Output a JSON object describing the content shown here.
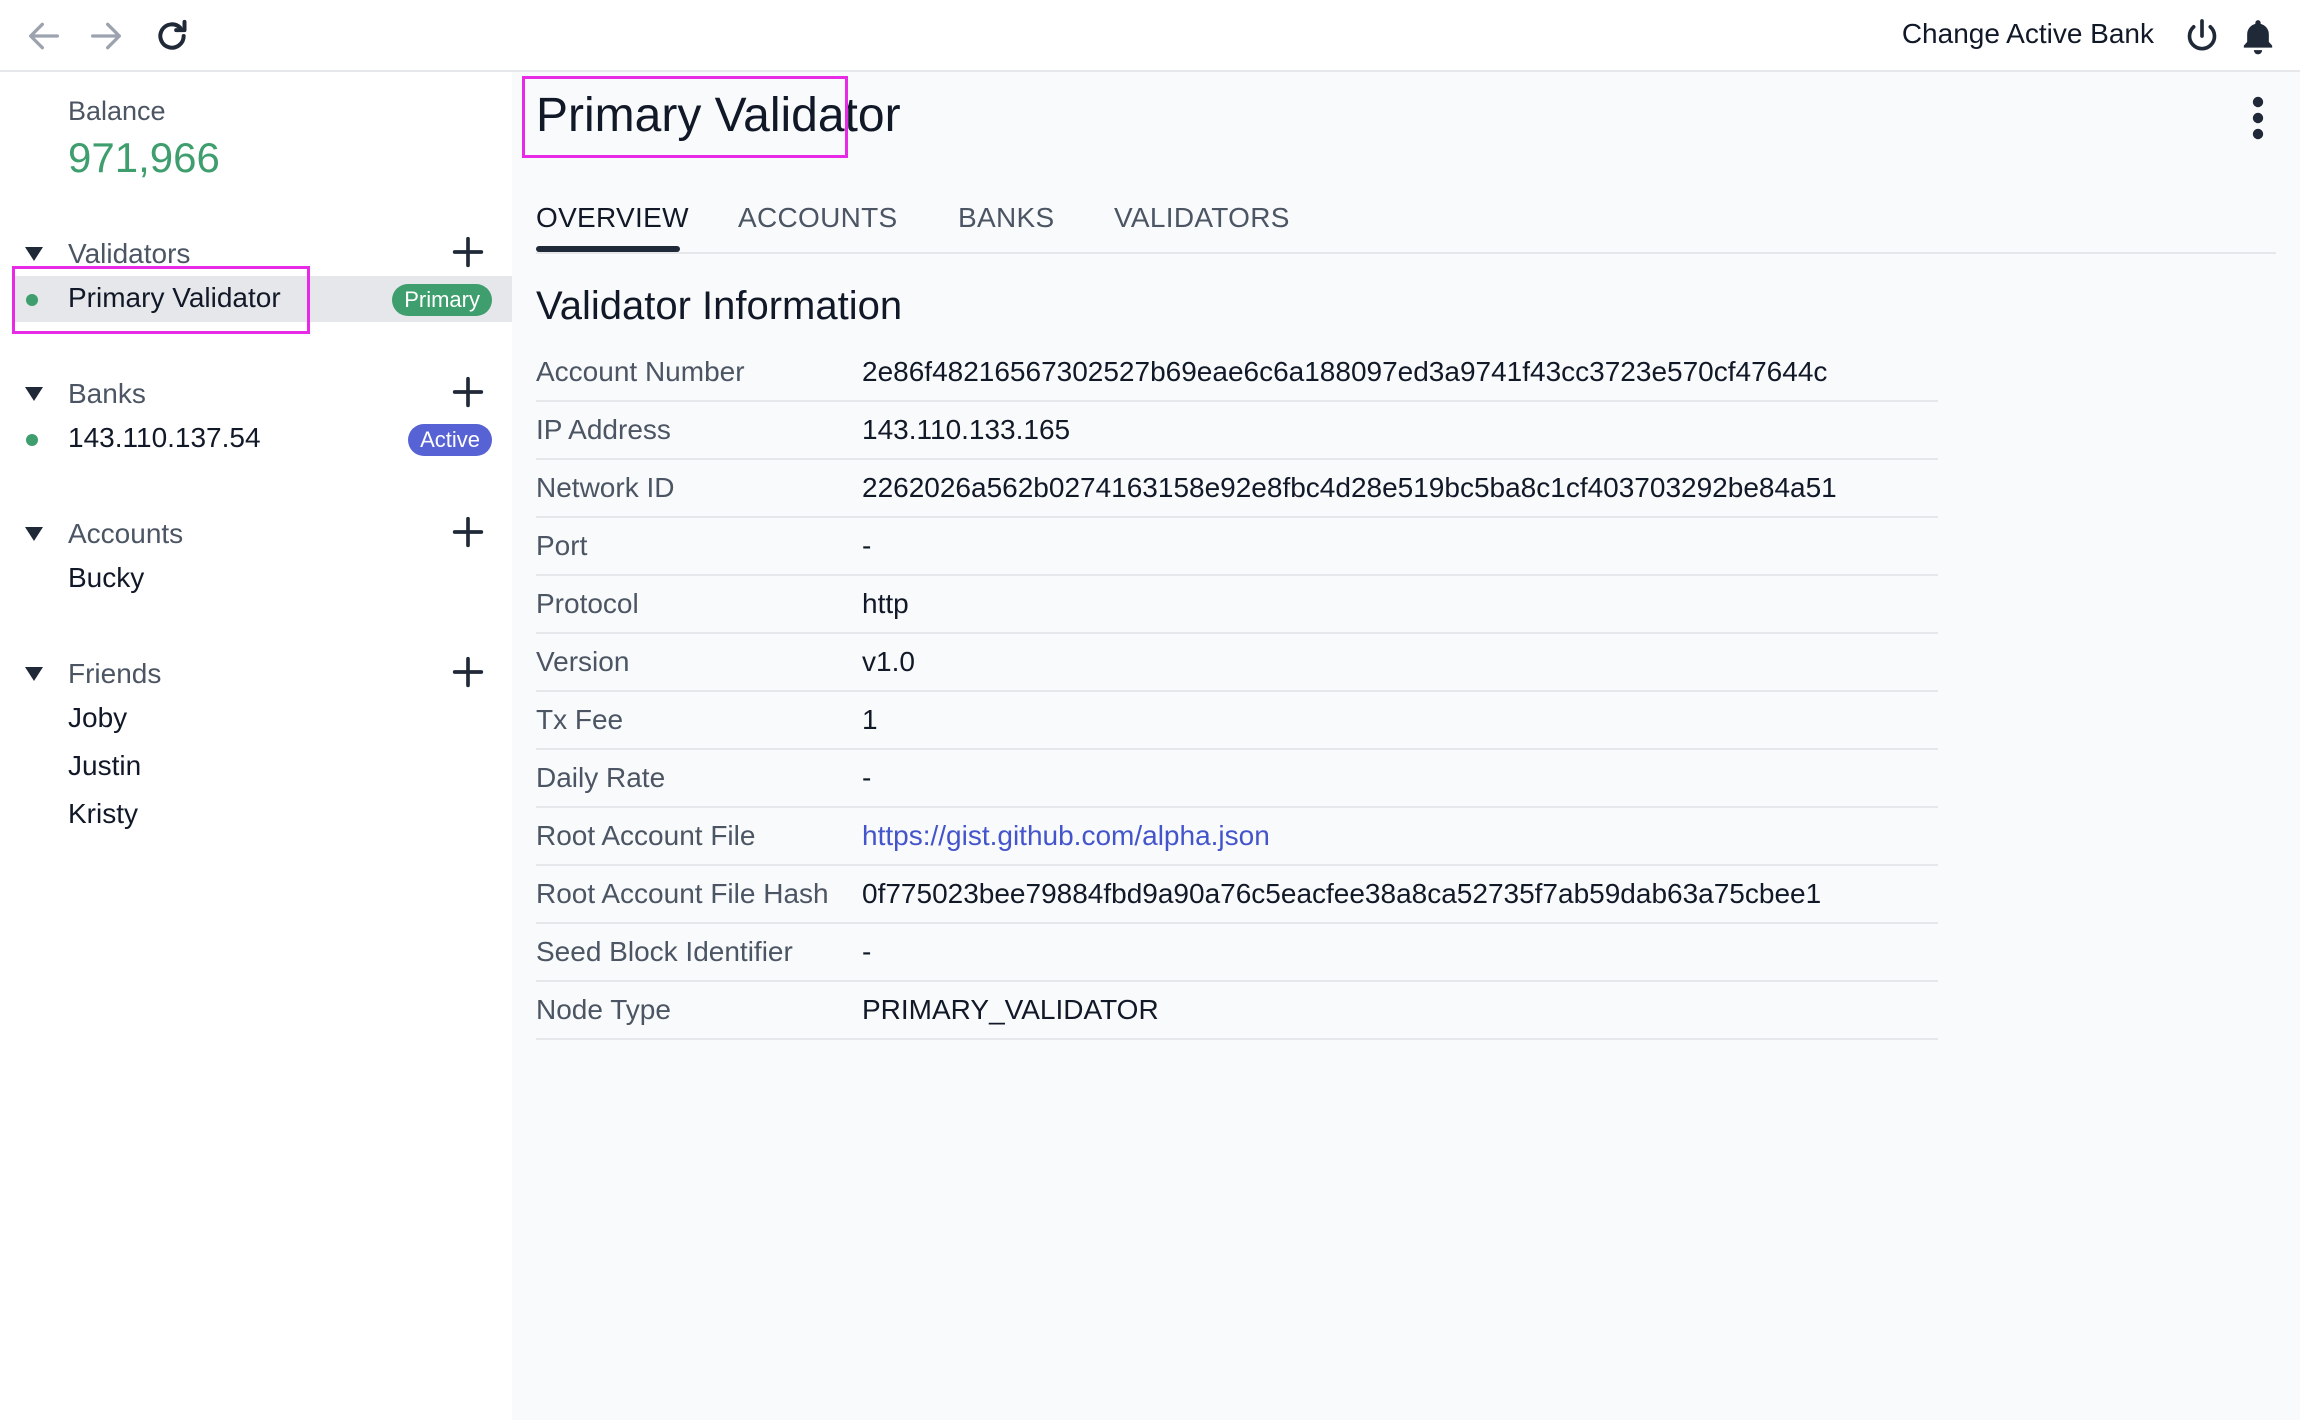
{
  "topbar": {
    "change_bank_label": "Change Active Bank",
    "icons": [
      "arrow-back-icon",
      "arrow-forward-icon",
      "refresh-icon",
      "power-icon",
      "bell-icon"
    ]
  },
  "sidebar": {
    "balance_label": "Balance",
    "balance_value": "971,966",
    "sections": {
      "validators": {
        "title": "Validators",
        "item": {
          "label": "Primary Validator",
          "badge": "Primary"
        }
      },
      "banks": {
        "title": "Banks",
        "item": {
          "label": "143.110.137.54",
          "badge": "Active"
        }
      },
      "accounts": {
        "title": "Accounts",
        "items": [
          "Bucky"
        ]
      },
      "friends": {
        "title": "Friends",
        "items": [
          "Joby",
          "Justin",
          "Kristy"
        ]
      }
    }
  },
  "main": {
    "title": "Primary Validator",
    "tabs": [
      "OVERVIEW",
      "ACCOUNTS",
      "BANKS",
      "VALIDATORS"
    ],
    "active_tab": "OVERVIEW",
    "section_title": "Validator Information",
    "rows": [
      {
        "key": "Account Number",
        "value": "2e86f48216567302527b69eae6c6a188097ed3a9741f43cc3723e570cf47644c"
      },
      {
        "key": "IP Address",
        "value": "143.110.133.165"
      },
      {
        "key": "Network ID",
        "value": "2262026a562b0274163158e92e8fbc4d28e519bc5ba8c1cf403703292be84a51"
      },
      {
        "key": "Port",
        "value": "-"
      },
      {
        "key": "Protocol",
        "value": "http"
      },
      {
        "key": "Version",
        "value": "v1.0"
      },
      {
        "key": "Tx Fee",
        "value": "1"
      },
      {
        "key": "Daily Rate",
        "value": "-"
      },
      {
        "key": "Root Account File",
        "value": "https://gist.github.com/alpha.json"
      },
      {
        "key": "Root Account File Hash",
        "value": "0f775023bee79884fbd9a90a76c5eacfee38a8ca52735f7ab59dab63a75cbee1"
      },
      {
        "key": "Seed Block Identifier",
        "value": "-"
      },
      {
        "key": "Node Type",
        "value": "PRIMARY_VALIDATOR"
      }
    ]
  },
  "colors": {
    "balance_green": "#3f9e6d",
    "active_badge": "#5762d5",
    "link_blue": "#4455cc",
    "highlight_magenta": "#e62ae6"
  }
}
